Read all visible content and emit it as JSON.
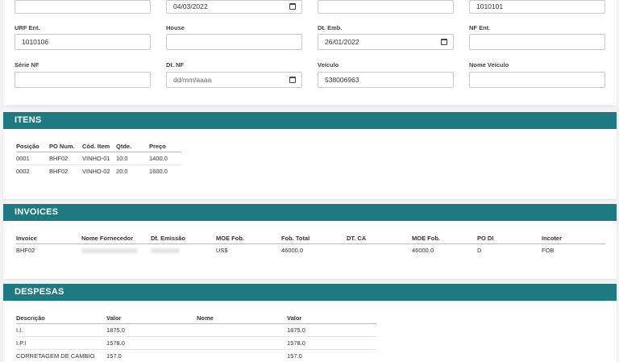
{
  "form": {
    "row1": {
      "col1_value": "",
      "col2_value": "04/03/2022",
      "col3_value": "",
      "col4_value": "1010101"
    },
    "row2": {
      "labels": [
        "URF Ent.",
        "House",
        "Dt. Emb.",
        "NF Ent."
      ],
      "values": [
        "1010106",
        "",
        "26/01/2022",
        ""
      ]
    },
    "row3": {
      "labels": [
        "Série NF",
        "Dt. NF",
        "Veículo",
        "Nome Veículo"
      ],
      "values": [
        "",
        "dd/mm/aaaa",
        "538006963",
        ""
      ]
    }
  },
  "itens": {
    "title": "ITENS",
    "headers": [
      "Posição",
      "PO Num.",
      "Cód. Item",
      "Qtde.",
      "Preço"
    ],
    "rows": [
      [
        "0001",
        "BHF02",
        "VINHO-01",
        "10.0",
        "1400.0"
      ],
      [
        "0002",
        "BHF02",
        "VINHO-02",
        "20.0",
        "1600.0"
      ]
    ]
  },
  "invoices": {
    "title": "INVOICES",
    "headers": [
      "Invoice",
      "Nome Fornecedor",
      "Dt. Emissão",
      "MOE Fob.",
      "Fob. Total",
      "DT. CA",
      "MOE Fob.",
      "PO DI",
      "Incoter"
    ],
    "rows": [
      [
        "BHF02",
        "",
        "",
        "US$",
        "46000.0",
        "",
        "46000.0",
        "D",
        "FOB"
      ]
    ]
  },
  "despesas": {
    "title": "DESPESAS",
    "headers": [
      "Descrição",
      "Valor",
      "Nome",
      "Valor"
    ],
    "rows": [
      [
        "I.I.",
        "1875.0",
        "",
        "1875.0"
      ],
      [
        "I.P.I",
        "1578.0",
        "",
        "1578.0"
      ],
      [
        "CORRETAGEM DE CAMBIO",
        "157.0",
        "",
        "157.0"
      ]
    ]
  }
}
